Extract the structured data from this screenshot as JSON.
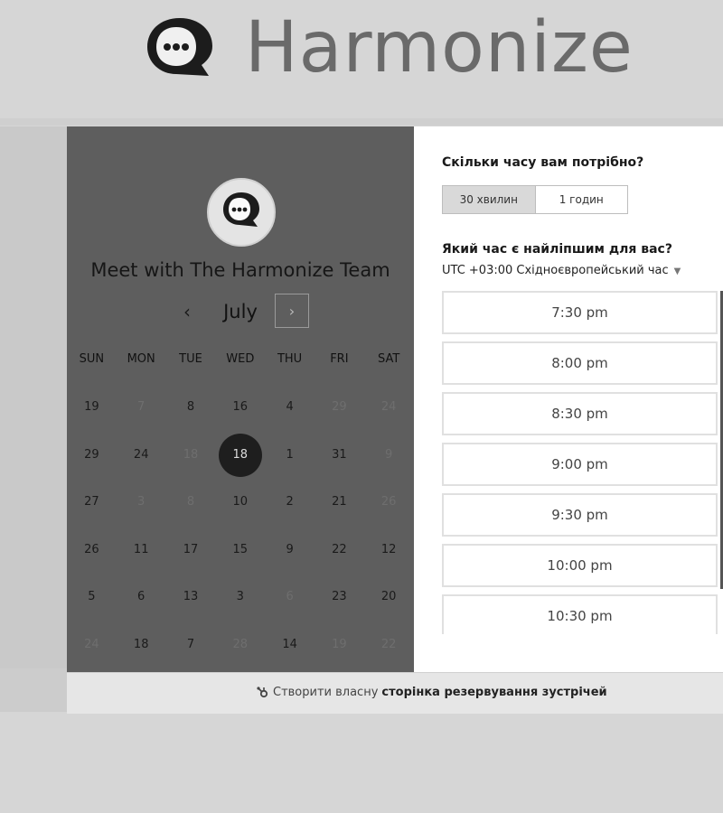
{
  "brand": {
    "name": "Harmonize"
  },
  "calendar": {
    "title": "Meet with The Harmonize Team",
    "month": "July",
    "prev": "‹",
    "next": "›",
    "weekdays": [
      "SUN",
      "MON",
      "TUE",
      "WED",
      "THU",
      "FRI",
      "SAT"
    ],
    "weeks": [
      [
        "19",
        "7",
        "8",
        "16",
        "4",
        "29",
        "24"
      ],
      [
        "29",
        "24",
        "18",
        "18",
        "1",
        "31",
        "9"
      ],
      [
        "27",
        "3",
        "8",
        "10",
        "2",
        "21",
        "26"
      ],
      [
        "26",
        "11",
        "17",
        "15",
        "9",
        "22",
        "12"
      ],
      [
        "5",
        "6",
        "13",
        "3",
        "6",
        "23",
        "20"
      ],
      [
        "24",
        "18",
        "7",
        "28",
        "14",
        "19",
        "22"
      ]
    ],
    "selected_day": "18"
  },
  "booking": {
    "duration_question": "Скільки часу вам потрібно?",
    "durations": [
      "30 хвилин",
      "1 годин"
    ],
    "time_question": "Який час є найліпшим для вас?",
    "timezone": "UTC +03:00 Східноєвропейський час",
    "slots": [
      "7:30 pm",
      "8:00 pm",
      "8:30 pm",
      "9:00 pm",
      "9:30 pm",
      "10:00 pm",
      "10:30 pm"
    ]
  },
  "footer": {
    "prefix": "Створити власну",
    "link": "сторінка резервування зустрічей"
  }
}
